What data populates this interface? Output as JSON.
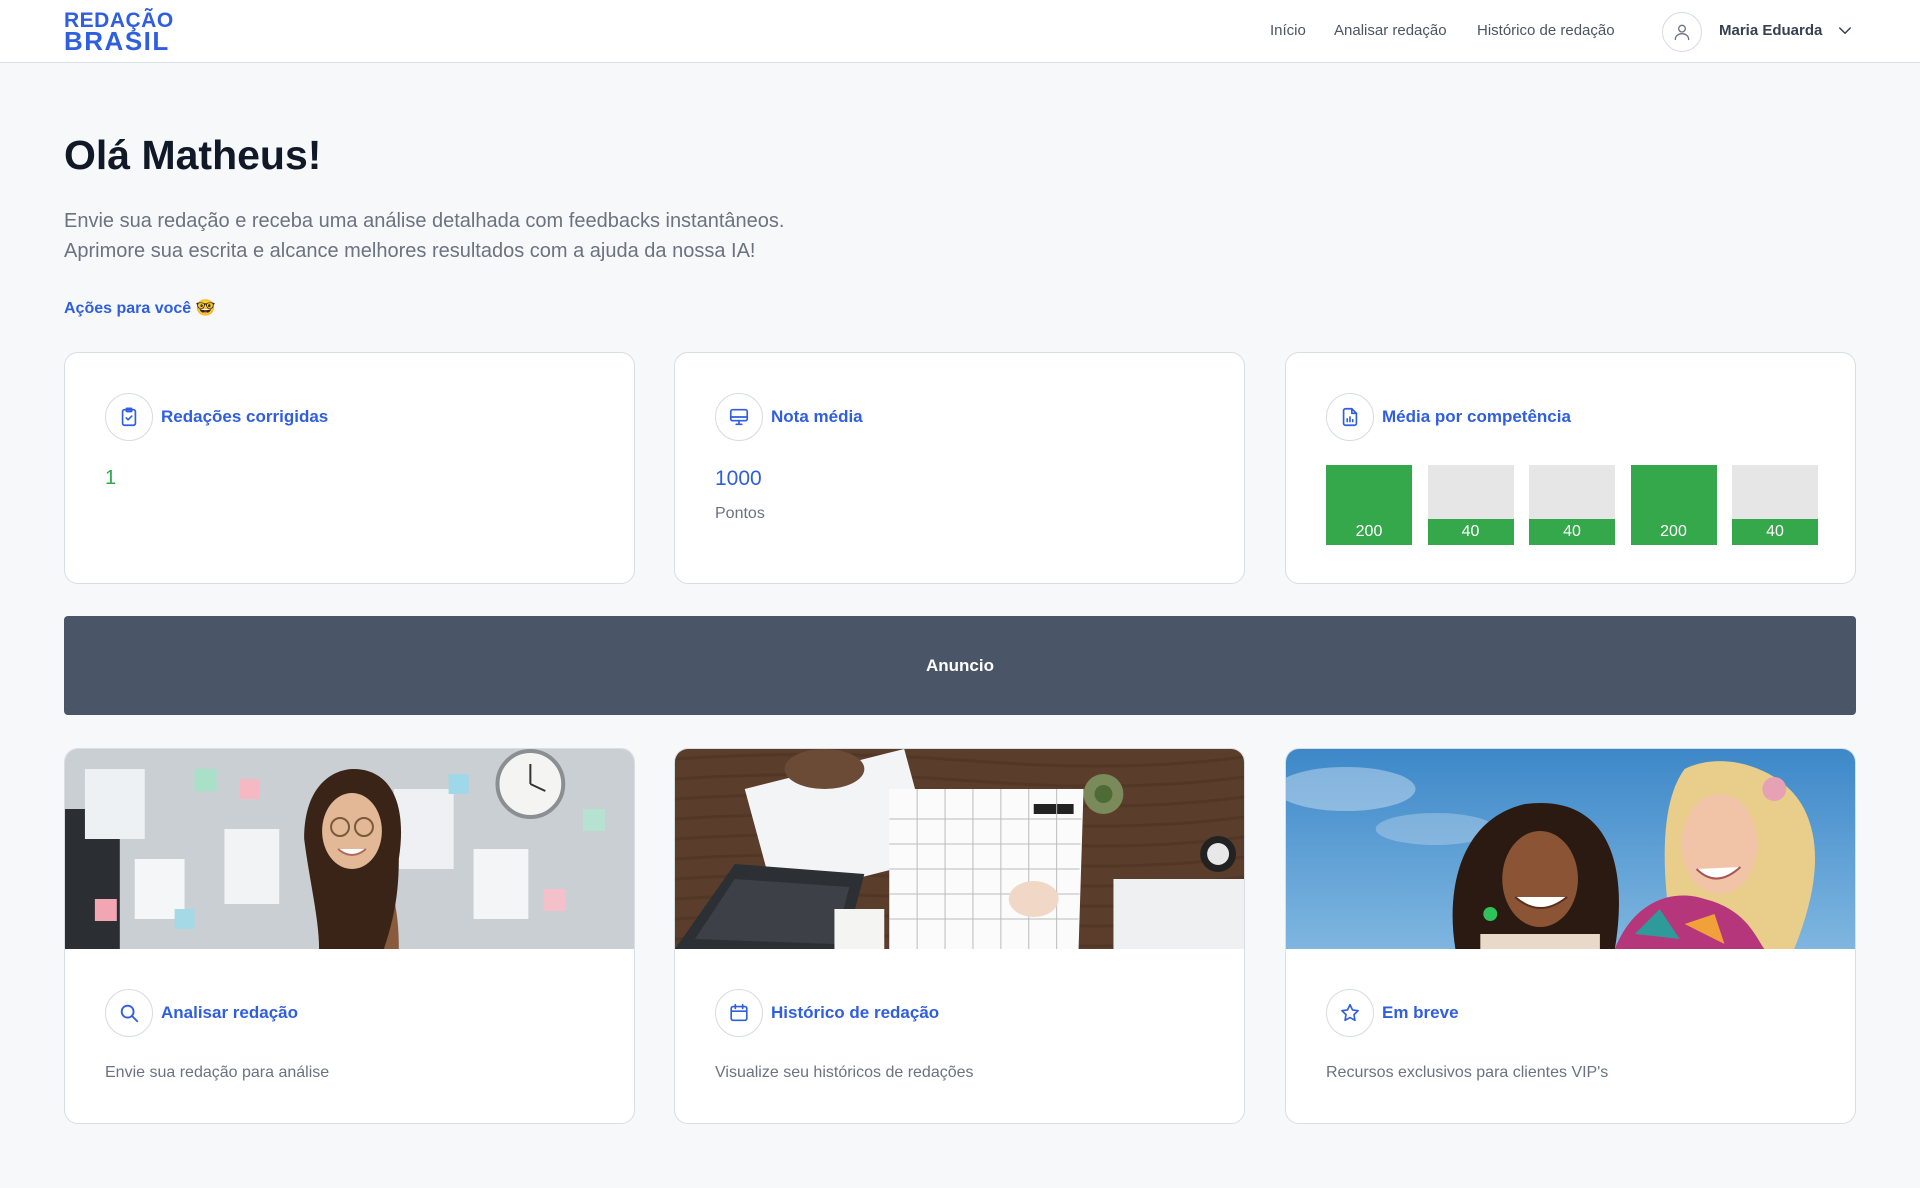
{
  "header": {
    "logo_line1": "REDAÇÃO",
    "logo_line2": "BRASIL",
    "nav": {
      "inicio": "Início",
      "analisar": "Analisar redação",
      "historico": "Histórico de redação"
    },
    "user": {
      "name": "Maria Eduarda",
      "avatar_icon": "user-icon",
      "menu_icon": "chevron-down-icon"
    }
  },
  "hero": {
    "greeting": "Olá Matheus!",
    "intro_line1": "Envie sua redação e receba uma análise detalhada com feedbacks instantâneos.",
    "intro_line2": "Aprimore sua escrita e alcance melhores resultados com a ajuda da nossa IA!",
    "section_label": "Ações para você 🤓"
  },
  "stats": {
    "corrected": {
      "title": "Redações corrigidas",
      "value": "1",
      "icon": "clipboard-check-icon"
    },
    "average": {
      "title": "Nota média",
      "value": "1000",
      "unit": "Pontos",
      "icon": "monitor-icon"
    },
    "competency": {
      "title": "Média por competência",
      "icon": "file-chart-icon",
      "max": 200,
      "items": [
        {
          "label": "200",
          "value": 200
        },
        {
          "label": "40",
          "value": 40
        },
        {
          "label": "40",
          "value": 40
        },
        {
          "label": "200",
          "value": 200
        },
        {
          "label": "40",
          "value": 40
        }
      ]
    }
  },
  "ad": {
    "label": "Anuncio"
  },
  "features": [
    {
      "title": "Analisar redação",
      "description": "Envie sua redação para análise",
      "icon": "search-icon",
      "image": "woman-smiling-photo"
    },
    {
      "title": "Histórico de redação",
      "description": "Visualize seu históricos de redações",
      "icon": "calendar-icon",
      "image": "calendar-desk-photo"
    },
    {
      "title": "Em breve",
      "description": "Recursos exclusivos para clientes VIP's",
      "icon": "star-icon",
      "image": "two-women-laughing-photo"
    }
  ],
  "colors": {
    "brand_blue": "#2f5ee0",
    "success_green": "#34a84a",
    "banner_gray": "#4a5568"
  }
}
